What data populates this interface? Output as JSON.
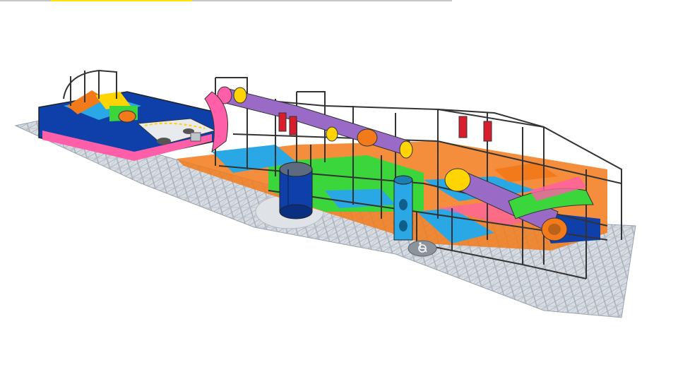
{
  "scene": {
    "subject": "",
    "accessibility_symbol": "wheelchair-icon"
  },
  "palette": {
    "floor_light": "#d8dde4",
    "floor_dark": "#a9b0ba",
    "frame": "#333333",
    "blue": "#0f3fa8",
    "sky": "#2aa8e6",
    "orange": "#f27a1a",
    "green": "#3bd63b",
    "pink": "#ff5ea8",
    "purple": "#9a6bc6",
    "yellow": "#ffd400",
    "red": "#d81e2c",
    "accent_bar": "#ffe600"
  }
}
